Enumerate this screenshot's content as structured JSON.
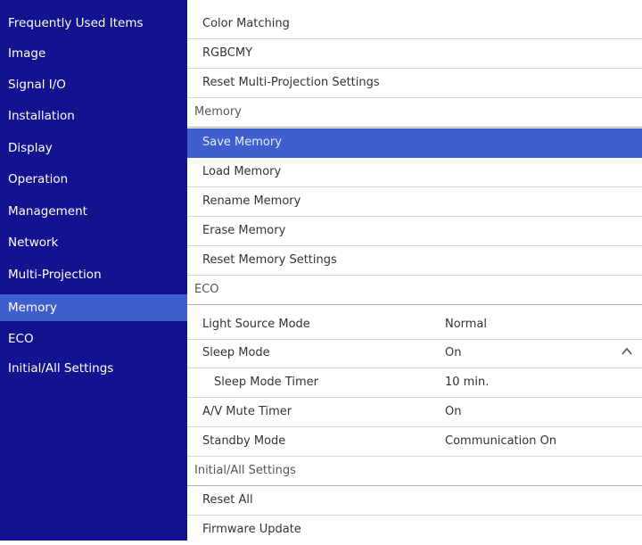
{
  "sidebar": {
    "items": [
      {
        "label": "Frequently Used Items"
      },
      {
        "label": "Image"
      },
      {
        "label": "Signal I/O"
      },
      {
        "label": "Installation"
      },
      {
        "label": "Display"
      },
      {
        "label": "Operation"
      },
      {
        "label": "Management"
      },
      {
        "label": "Network"
      },
      {
        "label": "Multi-Projection"
      },
      {
        "label": "Memory",
        "active": true
      },
      {
        "label": "ECO"
      },
      {
        "label": "Initial/All Settings"
      }
    ]
  },
  "main": {
    "rows": [
      {
        "label": "Color Matching"
      },
      {
        "label": "RGBCMY"
      },
      {
        "label": "Reset Multi-Projection Settings"
      },
      {
        "label": "Memory",
        "header": true
      },
      {
        "label": "Save Memory",
        "selected": true
      },
      {
        "label": "Load Memory"
      },
      {
        "label": "Rename Memory"
      },
      {
        "label": "Erase Memory"
      },
      {
        "label": "Reset Memory Settings"
      },
      {
        "label": "ECO",
        "header": true
      },
      {
        "label": "Light Source Mode",
        "value": "Normal"
      },
      {
        "label": "Sleep Mode",
        "value": "On",
        "icon": "chevron-up-icon"
      },
      {
        "label": "Sleep Mode Timer",
        "value": "10 min.",
        "indent": true
      },
      {
        "label": "A/V Mute Timer",
        "value": "On"
      },
      {
        "label": "Standby Mode",
        "value": "Communication On"
      },
      {
        "label": "Initial/All Settings",
        "header": true
      },
      {
        "label": "Reset All"
      },
      {
        "label": "Firmware Update"
      }
    ]
  },
  "colors": {
    "sidebar_bg": "#13138f",
    "highlight": "#3f5fcf"
  }
}
